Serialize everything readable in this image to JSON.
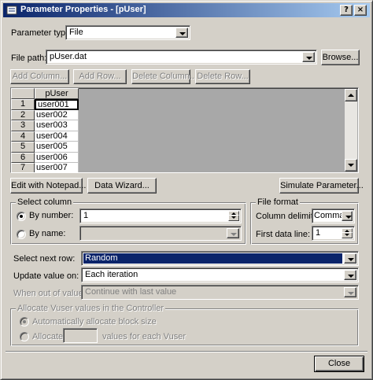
{
  "window": {
    "title": "Parameter Properties - [pUser]",
    "help_button": "?",
    "close_button": "×"
  },
  "parameter_type": {
    "label": "Parameter type:",
    "value": "File"
  },
  "file_path": {
    "label": "File path:",
    "value": "pUser.dat",
    "browse_label": "Browse..."
  },
  "grid_toolbar": {
    "add_column": "Add Column...",
    "add_row": "Add Row...",
    "delete_column": "Delete Column...",
    "delete_row": "Delete Row..."
  },
  "grid": {
    "column_header": "pUser",
    "rows": [
      {
        "num": "1",
        "value": "user001"
      },
      {
        "num": "2",
        "value": "user002"
      },
      {
        "num": "3",
        "value": "user003"
      },
      {
        "num": "4",
        "value": "user004"
      },
      {
        "num": "5",
        "value": "user005"
      },
      {
        "num": "6",
        "value": "user006"
      },
      {
        "num": "7",
        "value": "user007"
      }
    ]
  },
  "actions": {
    "edit_notepad": "Edit with Notepad...",
    "data_wizard": "Data Wizard...",
    "simulate": "Simulate Parameter..."
  },
  "select_column": {
    "title": "Select column",
    "by_number_label": "By number:",
    "by_number_value": "1",
    "by_name_label": "By name:",
    "by_name_value": ""
  },
  "file_format": {
    "title": "File format",
    "delimiter_label": "Column delimiter:",
    "delimiter_value": "Comma",
    "first_line_label": "First data line:",
    "first_line_value": "1"
  },
  "next_row": {
    "label": "Select next row:",
    "value": "Random"
  },
  "update_value": {
    "label": "Update value on:",
    "value": "Each iteration"
  },
  "out_of_values": {
    "label": "When out of values:",
    "value": "Continue with last value"
  },
  "allocate": {
    "title": "Allocate Vuser values in the Controller",
    "auto_label": "Automatically allocate block size",
    "allocate_label": "Allocate",
    "allocate_value": "",
    "allocate_suffix": "values for each Vuser"
  },
  "footer": {
    "close_label": "Close"
  },
  "colors": {
    "title_start": "#0a246a",
    "title_end": "#a6caf0",
    "face": "#d4d0c8",
    "highlight": "#0a246a"
  }
}
